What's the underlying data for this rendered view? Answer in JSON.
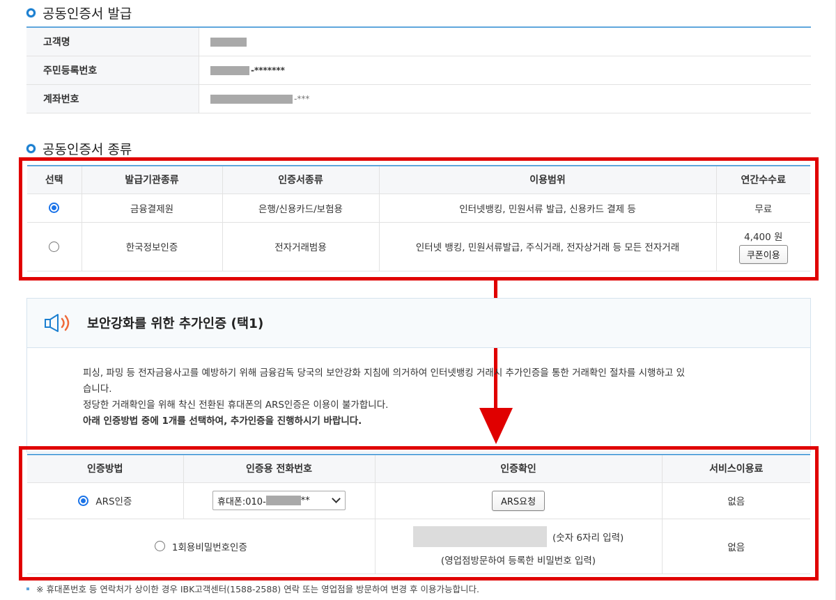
{
  "sections": {
    "issue_title": "공동인증서 발급",
    "type_title": "공동인증서 종류"
  },
  "customer_info": {
    "rows": [
      {
        "label": "고객명",
        "suffix": ""
      },
      {
        "label": "주민등록번호",
        "suffix": "-*******"
      },
      {
        "label": "계좌번호",
        "suffix": "-***"
      }
    ]
  },
  "cert_table": {
    "headers": [
      "선택",
      "발급기관종류",
      "인증서종류",
      "이용범위",
      "연간수수료"
    ],
    "rows": [
      {
        "selected": true,
        "issuer": "금융결제원",
        "type": "은행/신용카드/보험용",
        "scope": "인터넷뱅킹, 민원서류 발급, 신용카드 결제 등",
        "fee": "무료"
      },
      {
        "selected": false,
        "issuer": "한국정보인증",
        "type": "전자거래범용",
        "scope": "인터넷 뱅킹, 민원서류발급, 주식거래, 전자상거래 등 모든 전자거래",
        "fee": "4,400 원",
        "coupon_label": "쿠폰이용"
      }
    ]
  },
  "security": {
    "title": "보안강화를 위한 추가인증 (택1)",
    "line1": "피싱, 파밍 등 전자금융사고를 예방하기 위해 금융감독 당국의 보안강화 지침에 의거하여 인터넷뱅킹 거래시 추가인증을 통한 거래확인 절차를 시행하고 있",
    "line2": "습니다.",
    "line3": "정당한 거래확인을 위해 착신 전환된 휴대폰의 ARS인증은 이용이 불가합니다.",
    "line4": "아래 인증방법 중에 1개를 선택하여, 추가인증을 진행하시기 바랍니다."
  },
  "method_table": {
    "headers": [
      "인증방법",
      "인증용 전화번호",
      "인증확인",
      "서비스이용료"
    ],
    "ars": {
      "selected": true,
      "label": "ARS인증",
      "phone_prefix": "휴대폰:010-",
      "phone_suffix": "**",
      "button_label": "ARS요청",
      "fee": "없음"
    },
    "otp": {
      "selected": false,
      "label": "1회용비밀번호인증",
      "input_hint": "(숫자 6자리 입력)",
      "note": "(영업점방문하여 등록한 비밀번호 입력)",
      "fee": "없음"
    }
  },
  "footer_note": "※ 휴대폰번호 등 연락처가 상이한 경우 IBK고객센터(1588-2588) 연락 또는 영업점을 방문하여 변경 후 이용가능합니다.",
  "colors": {
    "accent_blue": "#1b7fd0",
    "highlight_red": "#e00000",
    "table_border": "#5ea6dc"
  }
}
